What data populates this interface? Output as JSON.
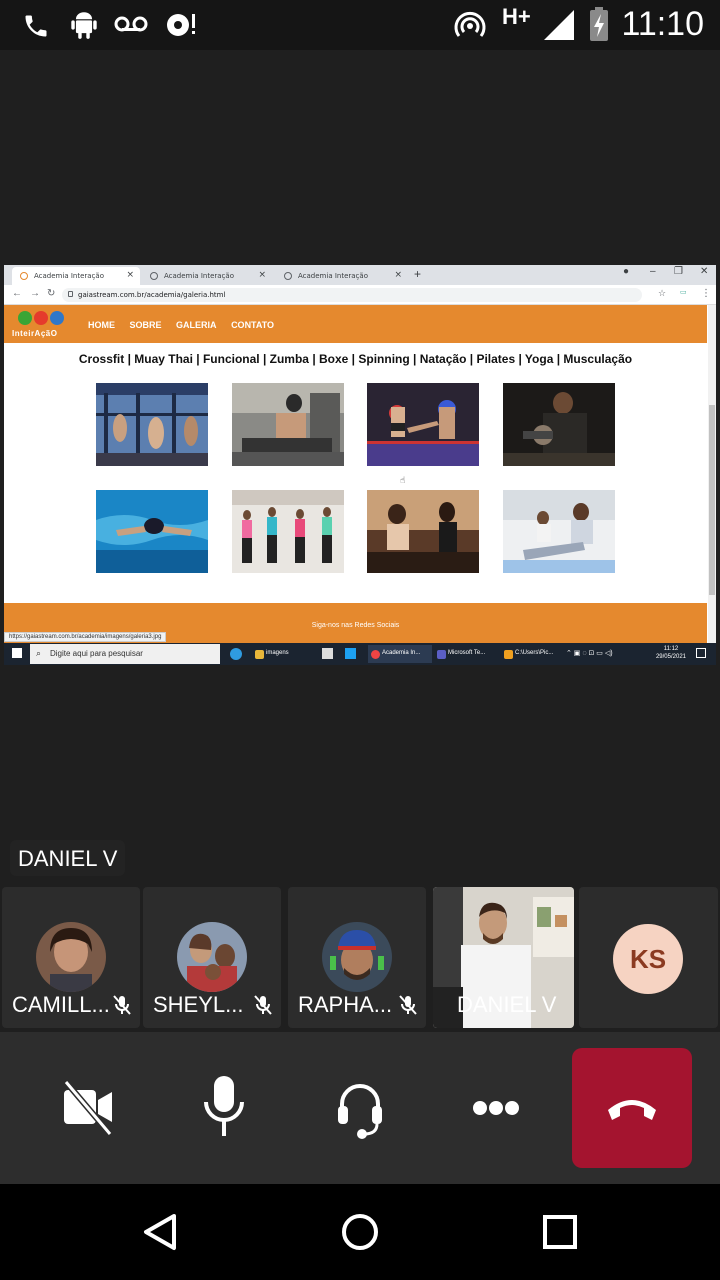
{
  "status_bar": {
    "time": "11:10",
    "network": "H+",
    "icons": [
      "phone-icon",
      "android-icon",
      "voicemail-icon",
      "sync-alert-icon",
      "hotspot-icon",
      "signal-icon",
      "battery-icon"
    ]
  },
  "browser": {
    "tabs": [
      {
        "label": "Academia Interação",
        "active": true
      },
      {
        "label": "Academia Interação",
        "active": false
      },
      {
        "label": "Academia Interação",
        "active": false
      }
    ],
    "url": "gaiastream.com.br/academia/galeria.html",
    "status_url": "https://gaiastream.com.br/academia/imagens/galeria3.jpg"
  },
  "site": {
    "logo_text": "InteirAçãO",
    "nav": [
      "HOME",
      "SOBRE",
      "GALERIA",
      "CONTATO"
    ],
    "categories": "Crossfit | Muay Thai | Funcional | Zumba | Boxe | Spinning | Natação | Pilates | Yoga | Musculação",
    "footer_text": "Siga-nos nas Redes Sociais",
    "gallery": [
      "crossfit-photo",
      "weightlifting-photo",
      "muay-thai-photo",
      "dumbbell-photo",
      "swimming-photo",
      "zumba-photo",
      "spinning-photo",
      "stretching-photo"
    ]
  },
  "taskbar": {
    "search_placeholder": "Digite aqui para pesquisar",
    "items": [
      "imagens",
      "Academia In...",
      "Microsoft Te...",
      "C:\\Users\\Pic..."
    ],
    "time": "11:12",
    "date": "29/05/2021"
  },
  "meeting": {
    "active_speaker": "DANIEL V",
    "participants": [
      {
        "name": "CAMILL...",
        "muted": true
      },
      {
        "name": "SHEYL...",
        "muted": true
      },
      {
        "name": "RAPHA...",
        "muted": true
      },
      {
        "name": "DANIEL V",
        "muted": false
      },
      {
        "name": "",
        "initials": "KS",
        "muted": false
      }
    ]
  },
  "colors": {
    "site_orange": "#e5892e",
    "hangup_red": "#a4142f",
    "background": "#1f1f1f"
  }
}
